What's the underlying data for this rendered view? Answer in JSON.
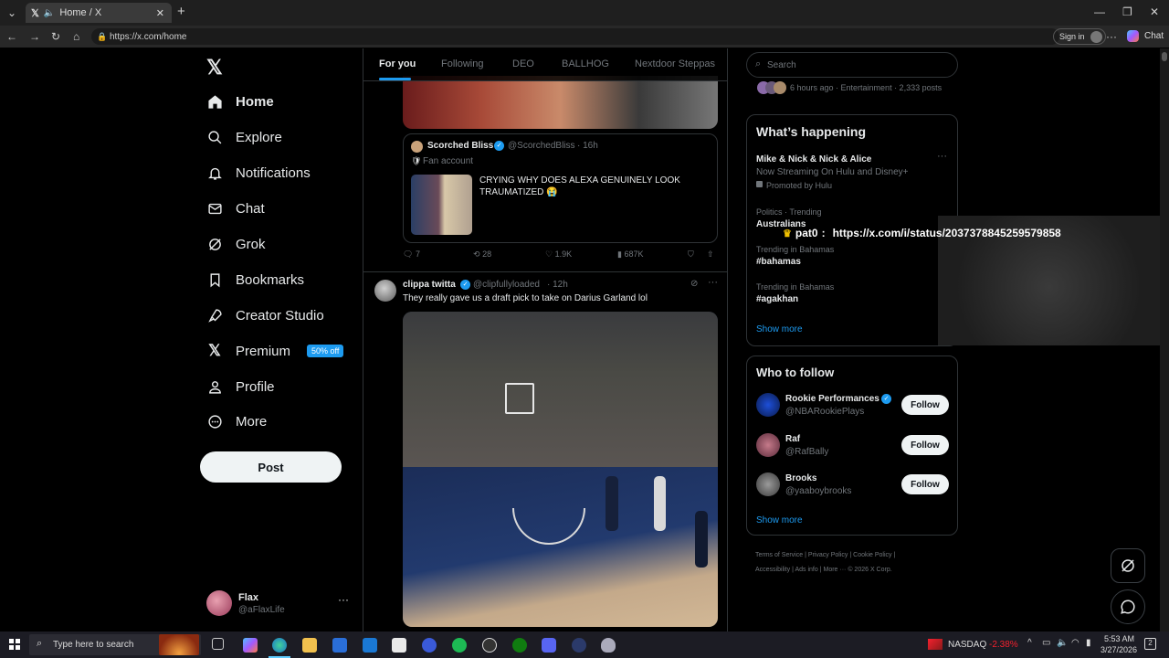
{
  "browser": {
    "tab_title": "Home / X",
    "url": "https://x.com/home",
    "signin_label": "Sign in",
    "chat_label": "Chat"
  },
  "nav": {
    "items": [
      {
        "label": "Home",
        "icon": "home-icon"
      },
      {
        "label": "Explore",
        "icon": "search-icon"
      },
      {
        "label": "Notifications",
        "icon": "bell-icon"
      },
      {
        "label": "Chat",
        "icon": "mail-icon"
      },
      {
        "label": "Grok",
        "icon": "grok-icon"
      },
      {
        "label": "Bookmarks",
        "icon": "bookmark-icon"
      },
      {
        "label": "Creator Studio",
        "icon": "rocket-icon"
      },
      {
        "label": "Premium",
        "icon": "x-logo-icon"
      },
      {
        "label": "Profile",
        "icon": "person-icon"
      },
      {
        "label": "More",
        "icon": "more-circle-icon"
      }
    ],
    "premium_badge": "50% off",
    "post_label": "Post",
    "account": {
      "name": "Flax",
      "handle": "@aFlaxLife"
    }
  },
  "feed": {
    "tabs": [
      "For you",
      "Following",
      "DEO",
      "BALLHOG",
      "Nextdoor Steppas"
    ],
    "quoted": {
      "name": "Scorched Bliss",
      "handle": "@ScorchedBliss",
      "time": "· 16h",
      "tag": "Fan account",
      "text": "CRYING WHY DOES ALEXA GENUINELY LOOK TRAUMATIZED 😭"
    },
    "actions1": {
      "replies": "7",
      "reposts": "28",
      "likes": "1.9K",
      "views": "687K"
    },
    "tweet2": {
      "name": "clippa twitta",
      "handle": "@clipfullyloaded",
      "time": "· 12h",
      "text": "They really gave us a draft pick to take on Darius Garland lol"
    }
  },
  "right": {
    "search_placeholder": "Search",
    "trend_meta": "6 hours ago · Entertainment · 2,333 posts",
    "happening_title": "What’s happening",
    "trends": [
      {
        "meta": "",
        "title": "Mike & Nick & Nick & Alice",
        "sub": "Now Streaming On Hulu and Disney+",
        "promo": "Promoted by Hulu"
      },
      {
        "meta": "Politics · Trending",
        "title": "Australians",
        "sub": "",
        "promo": ""
      },
      {
        "meta": "Trending in Bahamas",
        "title": "#bahamas",
        "sub": "",
        "promo": ""
      },
      {
        "meta": "Trending in Bahamas",
        "title": "#agakhan",
        "sub": "",
        "promo": ""
      }
    ],
    "show_more": "Show more",
    "follow_title": "Who to follow",
    "follow": [
      {
        "name": "Rookie Performances",
        "handle": "@NBARookiePlays",
        "btn": "Follow"
      },
      {
        "name": "Raf",
        "handle": "@RafBally",
        "btn": "Follow"
      },
      {
        "name": "Brooks",
        "handle": "@yaaboybrooks",
        "btn": "Follow"
      }
    ],
    "show_more2": "Show more",
    "footer": [
      "Terms of Service",
      "Privacy Policy",
      "Cookie Policy",
      "Accessibility",
      "Ads info",
      "More ···",
      "© 2026 X Corp."
    ]
  },
  "overlay": {
    "user": "pat0",
    "text": "https://x.com/i/status/2037378845259579858"
  },
  "taskbar": {
    "search_placeholder": "Type here to search",
    "ticker": "NASDAQ",
    "ticker_change": "-2.38%",
    "time": "5:53 AM",
    "date": "3/27/2026"
  },
  "colors": {
    "accent": "#1d9bf0",
    "background": "#000000",
    "border": "#2f3336",
    "negative": "#f4212e"
  }
}
